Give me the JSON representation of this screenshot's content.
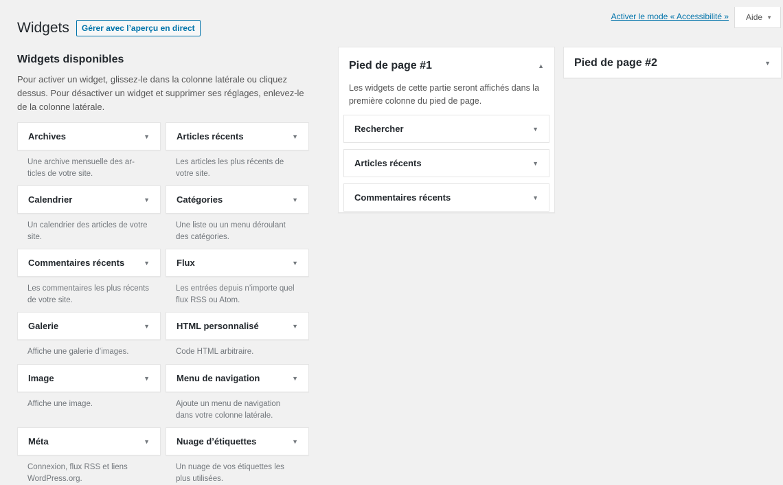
{
  "screen_meta": {
    "accessibility_link": "Activer le mode « Accessibilité »",
    "help_label": "Aide",
    "help_caret_icon": "caret-down-icon"
  },
  "header": {
    "title": "Widgets",
    "live_preview_button": "Gérer avec l’aperçu en direct"
  },
  "available": {
    "heading": "Widgets disponibles",
    "description": "Pour activer un widget, glissez-le dans la colonne latérale ou cliquez dessus. Pour désactiver un widget et supprimer ses réglages, enlevez-le de la colonne latérale.",
    "widgets": [
      {
        "title": "Archives",
        "desc": "Une archive mensuelle des ar- ticles de votre site."
      },
      {
        "title": "Articles récents",
        "desc": "Les articles les plus récents de votre site."
      },
      {
        "title": "Calendrier",
        "desc": "Un calendrier des articles de votre site."
      },
      {
        "title": "Catégories",
        "desc": "Une liste ou un menu déroulant des catégories."
      },
      {
        "title": "Commentaires récents",
        "desc": "Les commentaires les plus récents de votre site."
      },
      {
        "title": "Flux",
        "desc": "Les entrées depuis n’importe quel flux RSS ou Atom."
      },
      {
        "title": "Galerie",
        "desc": "Affiche une galerie d’images."
      },
      {
        "title": "HTML personnalisé",
        "desc": "Code HTML arbitraire."
      },
      {
        "title": "Image",
        "desc": "Affiche une image."
      },
      {
        "title": "Menu de navigation",
        "desc": "Ajoute un menu de navigation dans votre colonne latérale."
      },
      {
        "title": "Méta",
        "desc": "Connexion, flux RSS et liens WordPress.org."
      },
      {
        "title": "Nuage d’étiquettes",
        "desc": "Un nuage de vos étiquettes les plus utilisées."
      }
    ]
  },
  "sidebars": [
    {
      "title": "Pied de page #1",
      "arrow_icon": "caret-up-icon",
      "description": "Les widgets de cette partie seront affichés dans la première colonne du pied de page.",
      "widgets": [
        "Rechercher",
        "Articles récents",
        "Commentaires récents"
      ]
    },
    {
      "title": "Pied de page #2",
      "arrow_icon": "caret-down-icon"
    }
  ]
}
